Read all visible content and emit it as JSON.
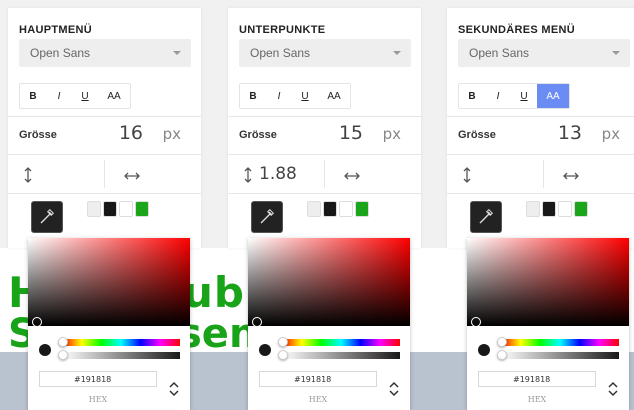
{
  "background": {
    "logo_line1_a": "H",
    "logo_line1_b": "ub",
    "logo_line2_a": "S",
    "logo_line2_b": "sen"
  },
  "panels": [
    {
      "title": "HAUPTMENÜ",
      "font": "Open Sans",
      "style_buttons": [
        "B",
        "I",
        "U",
        "AA"
      ],
      "aa_active": false,
      "size_label": "Grösse",
      "size_value": "16",
      "size_unit": "px",
      "line_height": "",
      "letter_spacing": "",
      "swatches": [
        "#eeeeee",
        "#191818",
        "#ffffff",
        "#1aa51a"
      ]
    },
    {
      "title": "UNTERPUNKTE",
      "font": "Open Sans",
      "style_buttons": [
        "B",
        "I",
        "U",
        "AA"
      ],
      "aa_active": false,
      "size_label": "Grösse",
      "size_value": "15",
      "size_unit": "px",
      "line_height": "1.88",
      "letter_spacing": "",
      "swatches": [
        "#eeeeee",
        "#191818",
        "#ffffff",
        "#1aa51a"
      ]
    },
    {
      "title": "SEKUNDÄRES MENÜ",
      "font": "Open Sans",
      "style_buttons": [
        "B",
        "I",
        "U",
        "AA"
      ],
      "aa_active": true,
      "size_label": "Grösse",
      "size_value": "13",
      "size_unit": "px",
      "line_height": "",
      "letter_spacing": "",
      "swatches": [
        "#eeeeee",
        "#191818",
        "#ffffff",
        "#1aa51a"
      ]
    }
  ],
  "pickers": [
    {
      "hex_value": "#191818",
      "mode_label": "HEX"
    },
    {
      "hex_value": "#191818",
      "mode_label": "HEX"
    },
    {
      "hex_value": "#191818",
      "mode_label": "HEX"
    }
  ],
  "colors": {
    "accent": "#6b8cf5",
    "brand_green": "#19a319"
  },
  "icons": {
    "caret": "chevron-down-icon",
    "line_height": "line-height-icon",
    "letter_spacing": "letter-spacing-icon",
    "pen": "eyedropper-icon",
    "mode_toggle": "up-down-toggle-icon"
  }
}
